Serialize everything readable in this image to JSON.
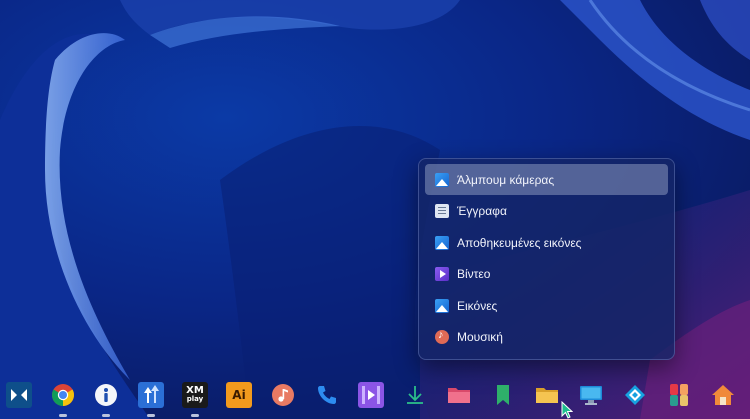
{
  "menu": {
    "items": [
      {
        "label": "Άλμπουμ κάμερας",
        "icon": "image-icon"
      },
      {
        "label": "Έγγραφα",
        "icon": "document-icon"
      },
      {
        "label": "Αποθηκευμένες εικόνες",
        "icon": "image-icon"
      },
      {
        "label": "Βίντεο",
        "icon": "video-icon"
      },
      {
        "label": "Εικόνες",
        "icon": "image-icon"
      },
      {
        "label": "Μουσική",
        "icon": "music-icon"
      }
    ],
    "active_index": 0
  },
  "dock": {
    "apps": [
      {
        "icon": "dolby-icon",
        "running": false
      },
      {
        "icon": "chrome-icon",
        "running": true
      },
      {
        "icon": "info-icon",
        "running": true
      },
      {
        "icon": "upload-arrows-icon",
        "running": true
      },
      {
        "icon": "xmplay-icon",
        "running": true,
        "label": "XM play"
      },
      {
        "icon": "illustrator-icon",
        "running": false,
        "label": "Ai"
      },
      {
        "icon": "music-app-icon",
        "running": false
      },
      {
        "icon": "phone-icon",
        "running": false
      },
      {
        "icon": "video-player-icon",
        "running": false
      },
      {
        "icon": "download-icon",
        "running": false
      },
      {
        "icon": "pink-folder-icon",
        "running": false
      },
      {
        "icon": "green-bookmark-icon",
        "running": false
      },
      {
        "icon": "yellow-folder-icon",
        "running": false
      },
      {
        "icon": "monitor-icon",
        "running": false
      },
      {
        "icon": "kodi-icon",
        "running": false
      },
      {
        "icon": "game-icon",
        "running": false
      },
      {
        "icon": "home-icon",
        "running": false
      }
    ]
  },
  "colors": {
    "wallpaper_base": "#0b2a8a",
    "wallpaper_purple": "#4a1a72",
    "menu_bg": "#142666"
  }
}
